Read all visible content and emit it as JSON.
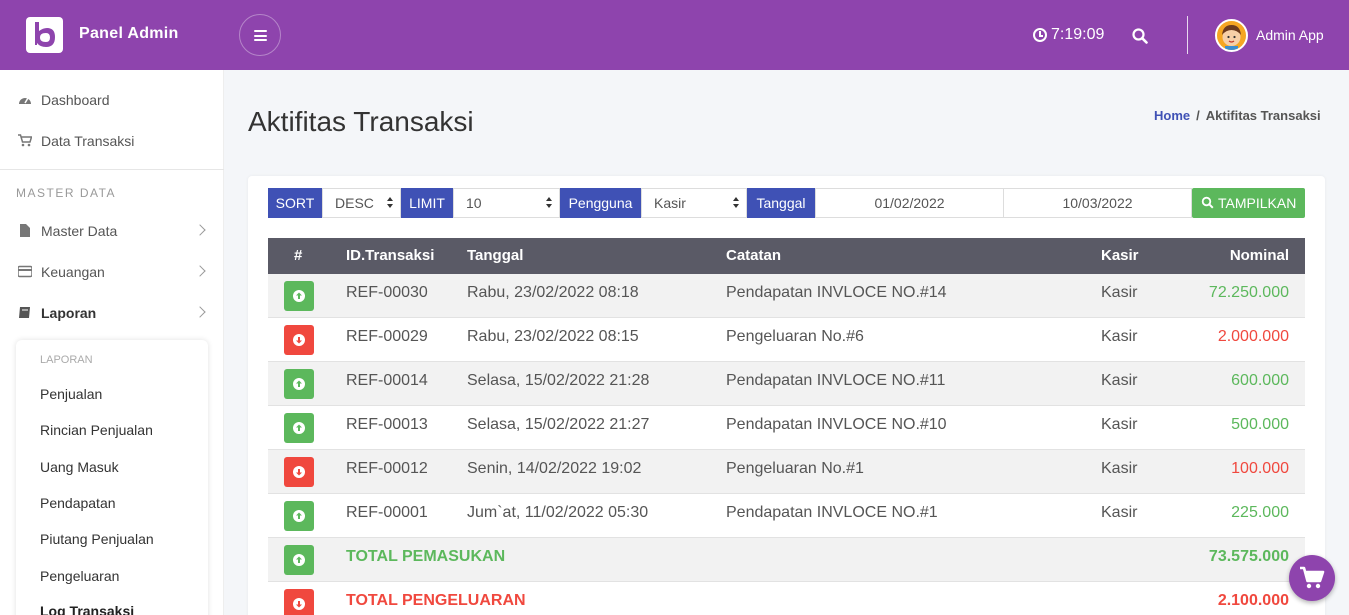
{
  "header": {
    "brand": "Panel Admin",
    "clock": "7:19:09",
    "user": "Admin App"
  },
  "sidebar": {
    "items": [
      {
        "label": "Dashboard"
      },
      {
        "label": "Data Transaksi"
      }
    ],
    "heading": "MASTER DATA",
    "groups": [
      {
        "label": "Master Data"
      },
      {
        "label": "Keuangan"
      },
      {
        "label": "Laporan"
      }
    ],
    "submenu": {
      "heading": "LAPORAN",
      "items": [
        "Penjualan",
        "Rincian Penjualan",
        "Uang Masuk",
        "Pendapatan",
        "Piutang Penjualan",
        "Pengeluaran",
        "Log Transaksi"
      ]
    }
  },
  "page": {
    "title": "Aktifitas Transaksi",
    "breadcrumb_home": "Home",
    "breadcrumb_sep": "/",
    "breadcrumb_current": "Aktifitas Transaksi"
  },
  "filters": {
    "sort_label": "SORT",
    "sort_value": "DESC",
    "limit_label": "LIMIT",
    "limit_value": "10",
    "user_label": "Pengguna",
    "user_value": "Kasir",
    "date_label": "Tanggal",
    "date_from": "01/02/2022",
    "date_to": "10/03/2022",
    "show_button": "TAMPILKAN"
  },
  "table": {
    "headers": [
      "#",
      "ID.Transaksi",
      "Tanggal",
      "Catatan",
      "Kasir",
      "Nominal"
    ],
    "rows": [
      {
        "type": "in",
        "id": "REF-00030",
        "date": "Rabu, 23/02/2022 08:18",
        "note": "Pendapatan INVLOCE NO.#14",
        "cashier": "Kasir",
        "amount": "72.250.000"
      },
      {
        "type": "out",
        "id": "REF-00029",
        "date": "Rabu, 23/02/2022 08:15",
        "note": "Pengeluaran No.#6",
        "cashier": "Kasir",
        "amount": "2.000.000"
      },
      {
        "type": "in",
        "id": "REF-00014",
        "date": "Selasa, 15/02/2022 21:28",
        "note": "Pendapatan INVLOCE NO.#11",
        "cashier": "Kasir",
        "amount": "600.000"
      },
      {
        "type": "in",
        "id": "REF-00013",
        "date": "Selasa, 15/02/2022 21:27",
        "note": "Pendapatan INVLOCE NO.#10",
        "cashier": "Kasir",
        "amount": "500.000"
      },
      {
        "type": "out",
        "id": "REF-00012",
        "date": "Senin, 14/02/2022 19:02",
        "note": "Pengeluaran No.#1",
        "cashier": "Kasir",
        "amount": "100.000"
      },
      {
        "type": "in",
        "id": "REF-00001",
        "date": "Jum`at, 11/02/2022 05:30",
        "note": "Pendapatan INVLOCE NO.#1",
        "cashier": "Kasir",
        "amount": "225.000"
      }
    ],
    "total_in_label": "TOTAL PEMASUKAN",
    "total_in_value": "73.575.000",
    "total_out_label": "TOTAL PENGELUARAN",
    "total_out_value": "2.100.000"
  },
  "colors": {
    "primary": "#8e44ad",
    "label_blue": "#3f51b5",
    "income": "#5cb85c",
    "expense": "#f0483e"
  }
}
